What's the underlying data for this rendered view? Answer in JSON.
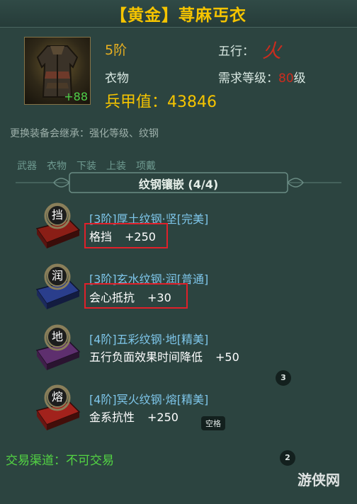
{
  "header": {
    "title": "【黄金】荨麻丐衣"
  },
  "item": {
    "icon": "ragged-robe-icon",
    "enhance": "+88",
    "tier": "5阶",
    "wuxing_label": "五行：",
    "wuxing_value": "火",
    "slot": "衣物",
    "req_prefix": "需求等级：",
    "req_level": "80",
    "req_suffix": "级",
    "armor": "兵甲值：43846"
  },
  "inherit_note": "更换装备会继承：强化等级、纹钢",
  "tabs": [
    "武器",
    "衣物",
    "下装",
    "上装",
    "项戴"
  ],
  "section": {
    "title": "纹钢镶嵌 (4/4)"
  },
  "gems": [
    {
      "char": "挡",
      "color": "#8a1e16",
      "name": "[3阶]厚土纹钢·坚[完美]",
      "stat_name": "格挡",
      "stat_value": "+250"
    },
    {
      "char": "润",
      "color": "#2a3e8c",
      "name": "[3阶]玄水纹钢·润[普通]",
      "stat_name": "会心抵抗",
      "stat_value": "+30"
    },
    {
      "char": "地",
      "color": "#5e2f6e",
      "name": "[4阶]五彩纹钢·地[精美]",
      "stat_name": "五行负面效果时间降低",
      "stat_value": "+50"
    },
    {
      "char": "熔",
      "color": "#a2221c",
      "name": "[4阶]冥火纹钢·熔[精美]",
      "stat_name": "金系抗性",
      "stat_value": "+250"
    }
  ],
  "badges": {
    "a": "3",
    "b": "2"
  },
  "tooltip": "空格",
  "trade": "交易渠道：不可交易",
  "watermark": "游侠网"
}
